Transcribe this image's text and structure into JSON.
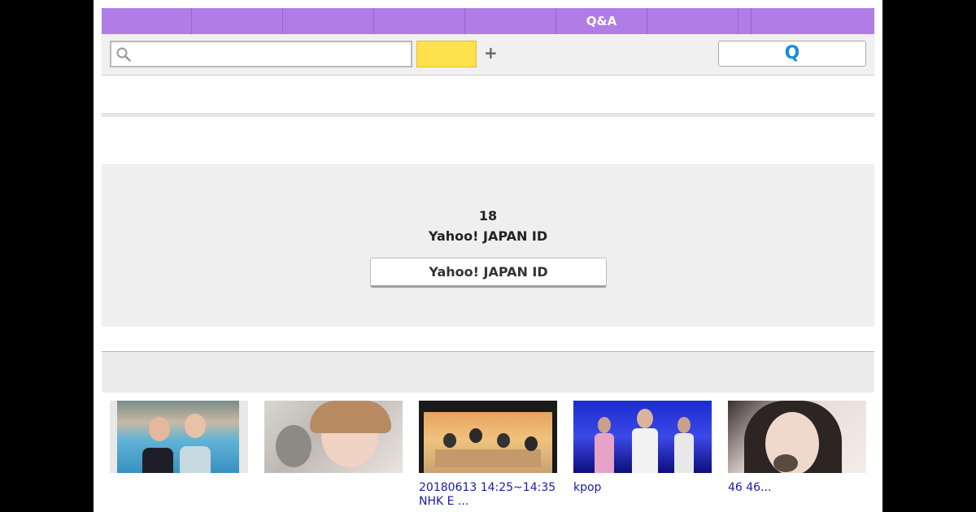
{
  "nav": {
    "tabs": [
      {
        "label": "",
        "width": 111
      },
      {
        "label": "",
        "width": 112
      },
      {
        "label": "",
        "width": 112
      },
      {
        "label": "",
        "width": 112
      },
      {
        "label": "",
        "width": 112
      },
      {
        "label": "Q&A",
        "width": 112
      },
      {
        "label": "",
        "width": 112
      },
      {
        "label": "",
        "width": 16
      },
      {
        "label": "",
        "width": 151
      }
    ]
  },
  "search": {
    "value": "",
    "plus_label": "+",
    "q_button_label": "Q"
  },
  "age_verify": {
    "line1": "18",
    "line2": "Yahoo! JAPAN ID",
    "login_button_label": "Yahoo! JAPAN ID"
  },
  "thumbnails": [
    {
      "caption": ""
    },
    {
      "caption": ""
    },
    {
      "caption": "20180613 14:25~14:35\nNHK E  ..."
    },
    {
      "caption": "kpop"
    },
    {
      "caption": "46 46..."
    }
  ],
  "colors": {
    "nav_bg": "#b07de6",
    "yellow_button": "#ffe14d",
    "q_accent": "#1a8bd8",
    "link": "#1a1aa6"
  }
}
